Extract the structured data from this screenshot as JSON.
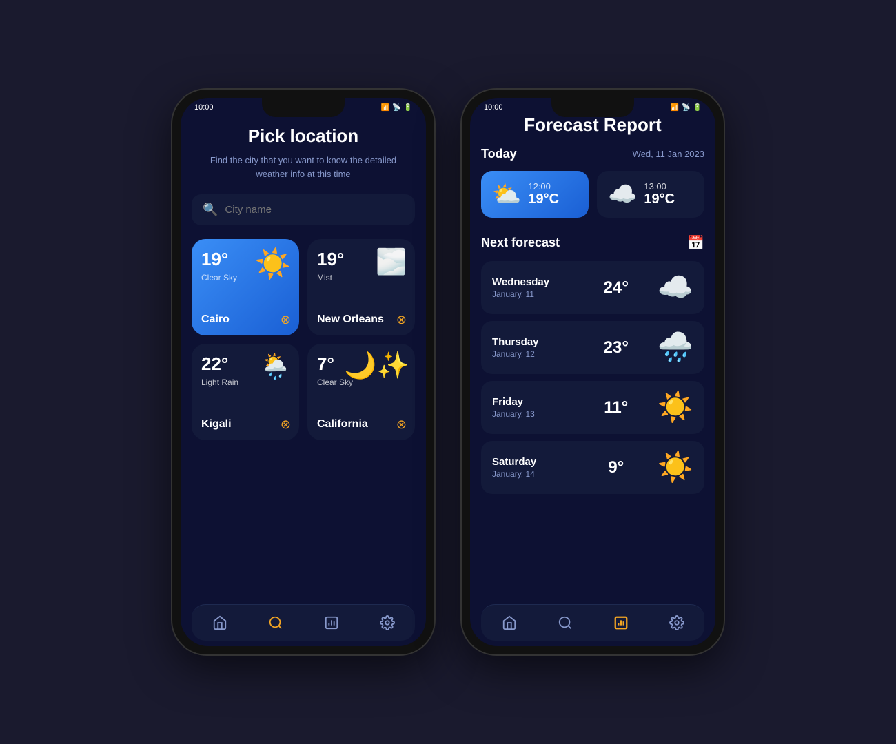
{
  "screen1": {
    "status_time": "10:00",
    "title": "Pick location",
    "subtitle": "Find the city that you want to know the detailed weather info at this time",
    "search_placeholder": "City name",
    "cities": [
      {
        "id": "cairo",
        "temp": "19°",
        "condition": "Clear Sky",
        "name": "Cairo",
        "icon": "☀️",
        "active": true
      },
      {
        "id": "new-orleans",
        "temp": "19°",
        "condition": "Mist",
        "name": "New Orleans",
        "icon": "🌫️",
        "active": false
      },
      {
        "id": "kigali",
        "temp": "22°",
        "condition": "Light Rain",
        "name": "Kigali",
        "icon": "⛅",
        "active": false
      },
      {
        "id": "california",
        "temp": "7°",
        "condition": "Clear Sky",
        "name": "California",
        "icon": "🌙",
        "active": false
      }
    ],
    "nav": [
      {
        "icon": "🏠",
        "label": "home",
        "active": false
      },
      {
        "icon": "🔍",
        "label": "search",
        "active": true
      },
      {
        "icon": "📊",
        "label": "report",
        "active": false
      },
      {
        "icon": "⚙️",
        "label": "settings",
        "active": false
      }
    ]
  },
  "screen2": {
    "status_time": "10:00",
    "title": "Forecast Report",
    "today_label": "Today",
    "today_date": "Wed, 11 Jan 2023",
    "hourly": [
      {
        "time": "12:00",
        "temp": "19°C",
        "icon": "⛅",
        "active": true
      },
      {
        "time": "13:00",
        "temp": "19°C",
        "icon": "☁️",
        "active": false
      }
    ],
    "next_forecast_label": "Next forecast",
    "forecast_rows": [
      {
        "day": "Wednesday",
        "date": "January, 11",
        "temp": "24°",
        "icon": "☁️"
      },
      {
        "day": "Thursday",
        "date": "January, 12",
        "temp": "23°",
        "icon": "🌧️"
      },
      {
        "day": "Friday",
        "date": "January, 13",
        "temp": "11°",
        "icon": "☀️"
      },
      {
        "day": "Saturday",
        "date": "January, 14",
        "temp": "9°",
        "icon": "☀️"
      }
    ],
    "nav": [
      {
        "icon": "🏠",
        "label": "home",
        "active": false
      },
      {
        "icon": "🔍",
        "label": "search",
        "active": false
      },
      {
        "icon": "📊",
        "label": "report",
        "active": true
      },
      {
        "icon": "⚙️",
        "label": "settings",
        "active": false
      }
    ]
  }
}
